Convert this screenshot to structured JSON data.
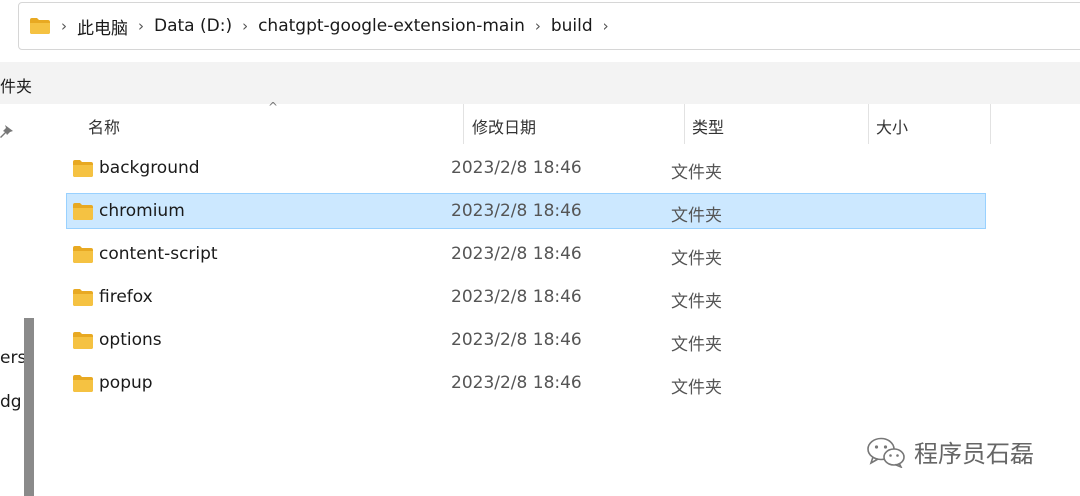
{
  "address_bar": {
    "crumbs": [
      "此电脑",
      "Data (D:)",
      "chatgpt-google-extension-main",
      "build"
    ]
  },
  "toolbar": {
    "partial_label": "件夹"
  },
  "nav_pane": {
    "items": [
      "ers",
      "dg"
    ]
  },
  "columns": {
    "name": "名称",
    "date": "修改日期",
    "type": "类型",
    "size": "大小"
  },
  "files": [
    {
      "name": "background",
      "date": "2023/2/8 18:46",
      "type": "文件夹",
      "selected": false
    },
    {
      "name": "chromium",
      "date": "2023/2/8 18:46",
      "type": "文件夹",
      "selected": true
    },
    {
      "name": "content-script",
      "date": "2023/2/8 18:46",
      "type": "文件夹",
      "selected": false
    },
    {
      "name": "firefox",
      "date": "2023/2/8 18:46",
      "type": "文件夹",
      "selected": false
    },
    {
      "name": "options",
      "date": "2023/2/8 18:46",
      "type": "文件夹",
      "selected": false
    },
    {
      "name": "popup",
      "date": "2023/2/8 18:46",
      "type": "文件夹",
      "selected": false
    }
  ],
  "watermark": {
    "text": "程序员石磊",
    "icon": "wechat-icon"
  },
  "colors": {
    "selection_bg": "#cce8ff",
    "selection_border": "#99d1ff",
    "folder": "#f5c242"
  }
}
